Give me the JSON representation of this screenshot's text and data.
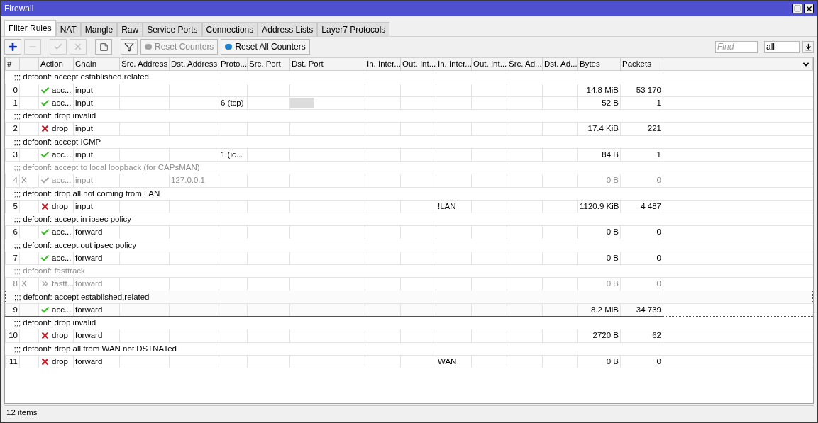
{
  "window": {
    "title": "Firewall"
  },
  "tabs": [
    {
      "label": "Filter Rules",
      "selected": true
    },
    {
      "label": "NAT",
      "selected": false
    },
    {
      "label": "Mangle",
      "selected": false
    },
    {
      "label": "Raw",
      "selected": false
    },
    {
      "label": "Service Ports",
      "selected": false
    },
    {
      "label": "Connections",
      "selected": false
    },
    {
      "label": "Address Lists",
      "selected": false
    },
    {
      "label": "Layer7 Protocols",
      "selected": false
    }
  ],
  "toolbar": {
    "reset_counters": {
      "label": "Reset Counters",
      "disabled": true
    },
    "reset_all_counters": {
      "label": "Reset All Counters",
      "disabled": false
    },
    "find": {
      "placeholder": "Find"
    },
    "filter_select": {
      "value": "all"
    }
  },
  "table": {
    "columns": [
      "#",
      "Action",
      "Chain",
      "Src. Address",
      "Dst. Address",
      "Proto...",
      "Src. Port",
      "Dst. Port",
      "In. Inter...",
      "Out. Int...",
      "In. Inter...",
      "Out. Int...",
      "Src. Ad...",
      "Dst. Ad...",
      "Bytes",
      "Packets"
    ],
    "rules": [
      {
        "comment": ";;; defconf: accept established,related",
        "number": "0",
        "disabled": false,
        "selected": false,
        "kind": "accept",
        "action": "acc...",
        "chain": "input",
        "bytes": "14.8 MiB",
        "packets": "53 170"
      },
      {
        "number": "1",
        "disabled": false,
        "selected": false,
        "kind": "accept",
        "action": "acc...",
        "chain": "input",
        "protocol": "6 (tcp)",
        "dst_port_marked": true,
        "bytes": "52 B",
        "packets": "1"
      },
      {
        "comment": ";;; defconf: drop invalid",
        "number": "2",
        "disabled": false,
        "selected": false,
        "kind": "drop",
        "action": "drop",
        "chain": "input",
        "bytes": "17.4 KiB",
        "packets": "221"
      },
      {
        "comment": ";;; defconf: accept ICMP",
        "number": "3",
        "disabled": false,
        "selected": false,
        "kind": "accept",
        "action": "acc...",
        "chain": "input",
        "protocol": "1 (ic...",
        "bytes": "84 B",
        "packets": "1"
      },
      {
        "comment": ";;; defconf: accept to local loopback (for CAPsMAN)",
        "number": "4",
        "flag": "X",
        "disabled": true,
        "selected": false,
        "kind": "accept",
        "action": "acc...",
        "chain": "input",
        "dst_address": "127.0.0.1",
        "bytes": "0 B",
        "packets": "0"
      },
      {
        "comment": ";;; defconf: drop all not coming from LAN",
        "number": "5",
        "disabled": false,
        "selected": false,
        "kind": "drop",
        "action": "drop",
        "chain": "input",
        "in_interface_list": "!LAN",
        "bytes": "1120.9 KiB",
        "packets": "4 487"
      },
      {
        "comment": ";;; defconf: accept in ipsec policy",
        "number": "6",
        "disabled": false,
        "selected": false,
        "kind": "accept",
        "action": "acc...",
        "chain": "forward",
        "bytes": "0 B",
        "packets": "0"
      },
      {
        "comment": ";;; defconf: accept out ipsec policy",
        "number": "7",
        "disabled": false,
        "selected": false,
        "kind": "accept",
        "action": "acc...",
        "chain": "forward",
        "bytes": "0 B",
        "packets": "0"
      },
      {
        "comment": ";;; defconf: fasttrack",
        "number": "8",
        "flag": "X",
        "disabled": true,
        "selected": false,
        "kind": "fasttrack",
        "action": "fastt...",
        "chain": "forward",
        "bytes": "0 B",
        "packets": "0"
      },
      {
        "comment": ";;; defconf: accept established,related",
        "number": "9",
        "disabled": false,
        "selected": true,
        "kind": "accept",
        "action": "acc...",
        "chain": "forward",
        "bytes": "8.2 MiB",
        "packets": "34 739"
      },
      {
        "comment": ";;; defconf: drop invalid",
        "number": "10",
        "disabled": false,
        "selected": false,
        "kind": "drop",
        "action": "drop",
        "chain": "forward",
        "bytes": "2720 B",
        "packets": "62"
      },
      {
        "comment": ";;; defconf: drop all from WAN not DSTNATed",
        "number": "11",
        "disabled": false,
        "selected": false,
        "kind": "drop",
        "action": "drop",
        "chain": "forward",
        "in_interface_list": "WAN",
        "bytes": "0 B",
        "packets": "0"
      }
    ]
  },
  "status_bar": {
    "text": "12 items"
  }
}
